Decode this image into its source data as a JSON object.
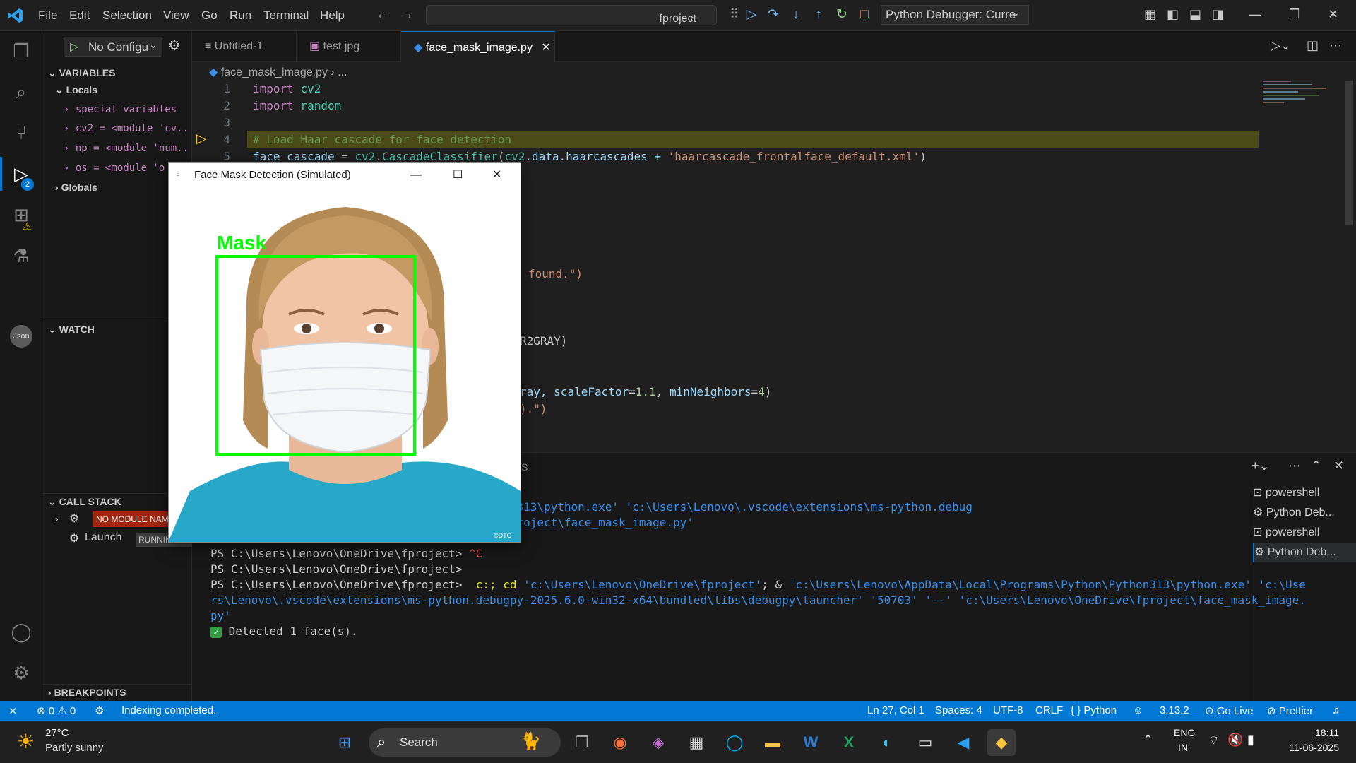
{
  "menu": [
    "File",
    "Edit",
    "Selection",
    "View",
    "Go",
    "Run",
    "Terminal",
    "Help"
  ],
  "search": {
    "text": "fproject"
  },
  "debug_config": {
    "label": "Python Debugger: Curre"
  },
  "run_config": {
    "label": "No Configu"
  },
  "sidebar": {
    "variables_title": "VARIABLES",
    "locals_label": "Locals",
    "locals": [
      "special variables",
      "cv2 = <module 'cv...",
      "np = <module 'num...",
      "os = <module 'o"
    ],
    "globals_label": "Globals",
    "watch_title": "WATCH",
    "callstack_title": "CALL STACK",
    "callstack_badge": "NO MODULE NAM",
    "callstack_launch": "Launch",
    "callstack_running": "RUNNING",
    "breakpoints_title": "BREAKPOINTS",
    "debug_badge": "2"
  },
  "tabs": [
    {
      "label": "Untitled-1"
    },
    {
      "label": "test.jpg"
    },
    {
      "label": "face_mask_image.py"
    }
  ],
  "breadcrumb": {
    "file": "face_mask_image.py",
    "rest": "..."
  },
  "code": {
    "l1_kw": "import",
    "l1_mod": " cv2",
    "l2_kw": "import",
    "l2_mod": " random",
    "l4_cmt": "# Load Haar cascade for face detection",
    "l5_var": "face_cascade",
    "l5_op": " = ",
    "l5_mod": "cv2",
    "l5_a": ".",
    "l5_fn": "CascadeClassifier",
    "l5_b": "(",
    "l5_c": "cv2",
    "l5_d": ".data.haarcascades + ",
    "l5_str": "'haarcascade_frontalface_default.xml'",
    "l5_e": ")",
    "frag1": "found.\")",
    "frag2": "R2GRAY)",
    "frag3_a": "ray, ",
    "frag3_b": "scaleFactor",
    "frag3_c": "=",
    "frag3_d": "1.1",
    "frag3_e": ", ",
    "frag3_f": "minNeighbors",
    "frag3_g": "=",
    "frag3_h": "4",
    "frag3_i": ")",
    "frag4": ").\")"
  },
  "line_numbers": [
    "1",
    "2",
    "3",
    "4",
    "5"
  ],
  "panel": {
    "tab_frag": "S",
    "t1": "s\\Lenovo\\AppData\\Local\\Programs\\Python\\Python313\\python.exe' 'c:\\Users\\Lenovo\\.vscode\\extensions\\ms-python.debug",
    "t2": "er' '50689' '--' 'c:\\Users\\Lenovo\\OneDrive\\fproject\\face_mask_image.py'",
    "t3_prompt": "PS C:\\Users\\Lenovo\\OneDrive\\fproject> ",
    "t3_ctrl": "^C",
    "t4": "PS C:\\Users\\Lenovo\\OneDrive\\fproject>",
    "t5_prompt": "PS C:\\Users\\Lenovo\\OneDrive\\fproject> ",
    "t5_cmd": " c:; cd ",
    "t5_p1": "'c:\\Users\\Lenovo\\OneDrive\\fproject'",
    "t5_mid": "; & ",
    "t5_p2": "'c:\\Users\\Lenovo\\AppData\\Local\\Programs\\Python\\Python313\\python.exe' 'c:\\Use",
    "t6": "rs\\Lenovo\\.vscode\\extensions\\ms-python.debugpy-2025.6.0-win32-x64\\bundled\\libs\\debugpy\\launcher' '50703' '--' 'c:\\Users\\Lenovo\\OneDrive\\fproject\\face_mask_image.",
    "t7": "py'",
    "t8_text": "Detected 1 face(s).",
    "terminals": [
      "powershell",
      "Python Deb...",
      "powershell",
      "Python Deb..."
    ]
  },
  "status": {
    "errors": "0",
    "warnings": "0",
    "indexing": "Indexing completed.",
    "position": "Ln 27, Col 1",
    "spaces": "Spaces: 4",
    "encoding": "UTF-8",
    "eol": "CRLF",
    "language": "Python",
    "py_version": "3.13.2",
    "golive": "Go Live",
    "prettier": "Prettier"
  },
  "face_window": {
    "title": "Face Mask Detection (Simulated)",
    "label": "Mask",
    "watermark": "©DTC"
  },
  "taskbar": {
    "temp": "27°C",
    "weather": "Partly sunny",
    "search": "Search",
    "lang1": "ENG",
    "lang2": "IN",
    "time": "18:11",
    "date": "11-06-2025"
  },
  "colors": {
    "accent": "#0078d4",
    "box": "#00ff00"
  }
}
